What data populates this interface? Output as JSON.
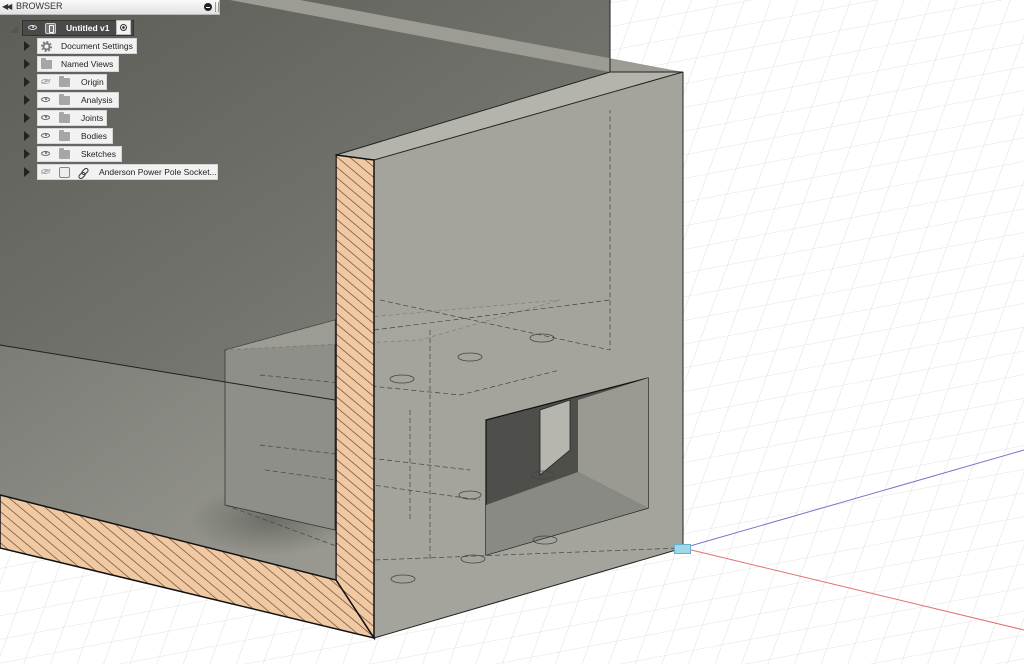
{
  "browser": {
    "title": "BROWSER",
    "root": {
      "label": "Untitled v1"
    },
    "items": [
      {
        "label": "Document Settings",
        "icon": "gear-icon",
        "visible": null
      },
      {
        "label": "Named Views",
        "icon": "folder-icon",
        "visible": null
      },
      {
        "label": "Origin",
        "icon": "folder-icon",
        "visible": false
      },
      {
        "label": "Analysis",
        "icon": "folder-icon",
        "visible": true
      },
      {
        "label": "Joints",
        "icon": "folder-icon",
        "visible": true
      },
      {
        "label": "Bodies",
        "icon": "folder-icon",
        "visible": true
      },
      {
        "label": "Sketches",
        "icon": "folder-icon",
        "visible": true
      },
      {
        "label": "Anderson Power Pole Socket...",
        "icon": "link-icon",
        "visible": false
      }
    ]
  },
  "colors": {
    "grid_line": "#d6d6d6",
    "red_axis": "#e07070",
    "blue_axis": "#7777cc",
    "section_hatch_bg": "#f0c8a2",
    "section_hatch_line": "#5a4330",
    "body_face": "#a4a49c",
    "inner_wall_dark": "#6c6c66"
  }
}
